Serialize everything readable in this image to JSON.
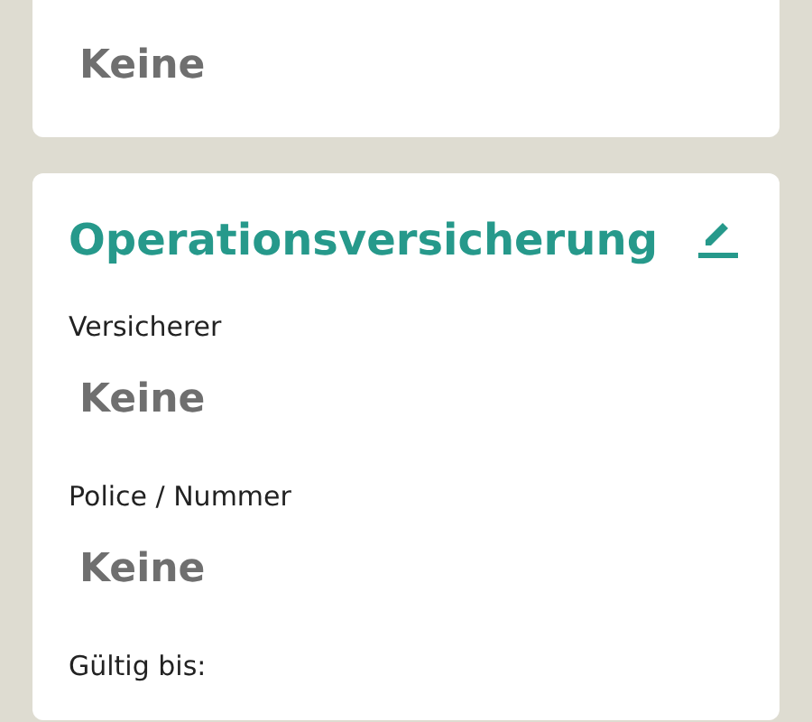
{
  "previous_card": {
    "fields": [
      {
        "value": "Keine"
      }
    ]
  },
  "card": {
    "title": "Operationsversicherung",
    "fields": [
      {
        "label": "Versicherer",
        "value": "Keine"
      },
      {
        "label": "Police / Nummer",
        "value": "Keine"
      },
      {
        "label": "Gültig bis:"
      }
    ]
  }
}
